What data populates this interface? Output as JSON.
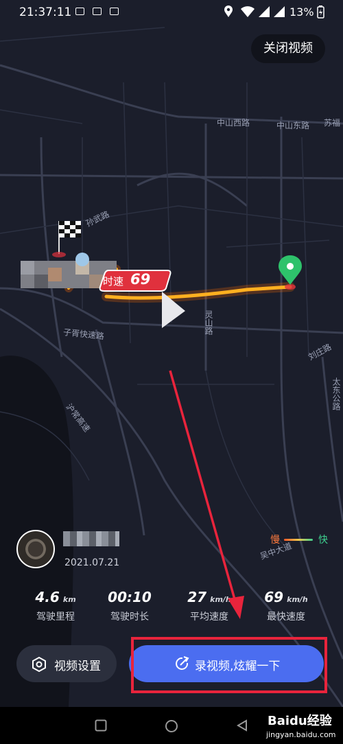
{
  "status_bar": {
    "time": "21:37:11",
    "battery": "13%"
  },
  "header": {
    "close_video_label": "关闭视频"
  },
  "map": {
    "roads": [
      "中山西路",
      "中山东路",
      "苏福",
      "孙武路",
      "灵山路",
      "子胥快速路",
      "刘庄路",
      "沪常高速",
      "太东公路",
      "吴中大道"
    ],
    "speed_badge_prefix": "时速",
    "speed_badge_value": "69"
  },
  "trip": {
    "date": "2021.07.21",
    "legend": {
      "slow": "慢",
      "fast": "快"
    },
    "stats": [
      {
        "value": "4.6",
        "unit": "km",
        "label": "驾驶里程"
      },
      {
        "value": "00:10",
        "unit": "",
        "label": "驾驶时长"
      },
      {
        "value": "27",
        "unit": "km/h",
        "label": "平均速度"
      },
      {
        "value": "69",
        "unit": "km/h",
        "label": "最快速度"
      }
    ]
  },
  "actions": {
    "settings_label": "视频设置",
    "record_label": "录视频,炫耀一下"
  },
  "watermark": {
    "brand": "Baidu经验",
    "url": "jingyan.baidu.com"
  },
  "colors": {
    "accent": "#4b6df0",
    "highlight": "#e8243c",
    "route": "#ff8a1f",
    "badge": "#e0313d",
    "map_bg": "#1b1e2b"
  }
}
